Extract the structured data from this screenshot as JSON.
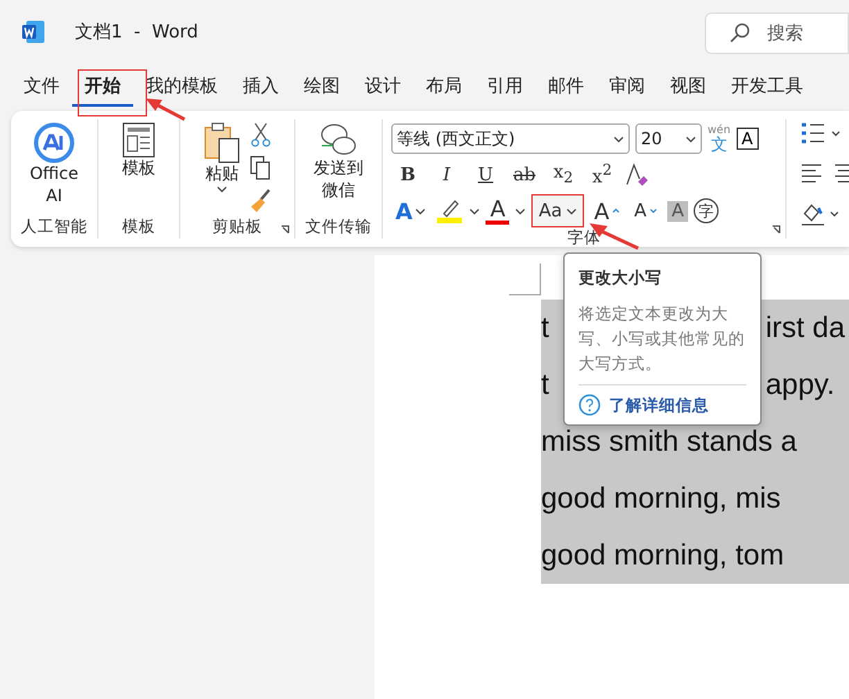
{
  "window": {
    "title": "文档1  -  Word",
    "search": {
      "placeholder": "搜索"
    }
  },
  "tabs": [
    {
      "label": "文件",
      "selected": false
    },
    {
      "label": "开始",
      "selected": true
    },
    {
      "label": "我的模板",
      "selected": false
    },
    {
      "label": "插入",
      "selected": false
    },
    {
      "label": "绘图",
      "selected": false
    },
    {
      "label": "设计",
      "selected": false
    },
    {
      "label": "布局",
      "selected": false
    },
    {
      "label": "引用",
      "selected": false
    },
    {
      "label": "邮件",
      "selected": false
    },
    {
      "label": "审阅",
      "selected": false
    },
    {
      "label": "视图",
      "selected": false
    },
    {
      "label": "开发工具",
      "selected": false
    }
  ],
  "ribbon": {
    "ai_group": {
      "button": "Office AI",
      "label": "人工智能"
    },
    "template_group": {
      "button": "模板",
      "label": "模板"
    },
    "clipboard_group": {
      "paste": "粘贴",
      "label": "剪贴板"
    },
    "transfer_group": {
      "button": "发送到微信",
      "label": "文件传输"
    },
    "font_group": {
      "font_name": "等线 (西文正文)",
      "font_size": "20",
      "phonetic_top": "wén",
      "phonetic_bottom": "文",
      "border_char": "A",
      "format_buttons": [
        "B",
        "I",
        "U",
        "ab",
        "x$_{2}$",
        "x$^{2}$"
      ],
      "effects": "A",
      "font_color": "A",
      "change_case": "Aa",
      "grow": "A",
      "shrink": "A",
      "shading": "A",
      "enclose": "字",
      "label": "字体"
    }
  },
  "tooltip": {
    "title": "更改大小写",
    "description": "将选定文本更改为大写、小写或其他常见的大写方式。",
    "link": "了解详细信息"
  },
  "document": {
    "lines": [
      [
        "t",
        "irst da"
      ],
      [
        "t",
        "appy."
      ],
      [
        "miss smith stands a"
      ],
      [
        "good morning, mis"
      ],
      [
        "good morning, tom"
      ]
    ]
  }
}
